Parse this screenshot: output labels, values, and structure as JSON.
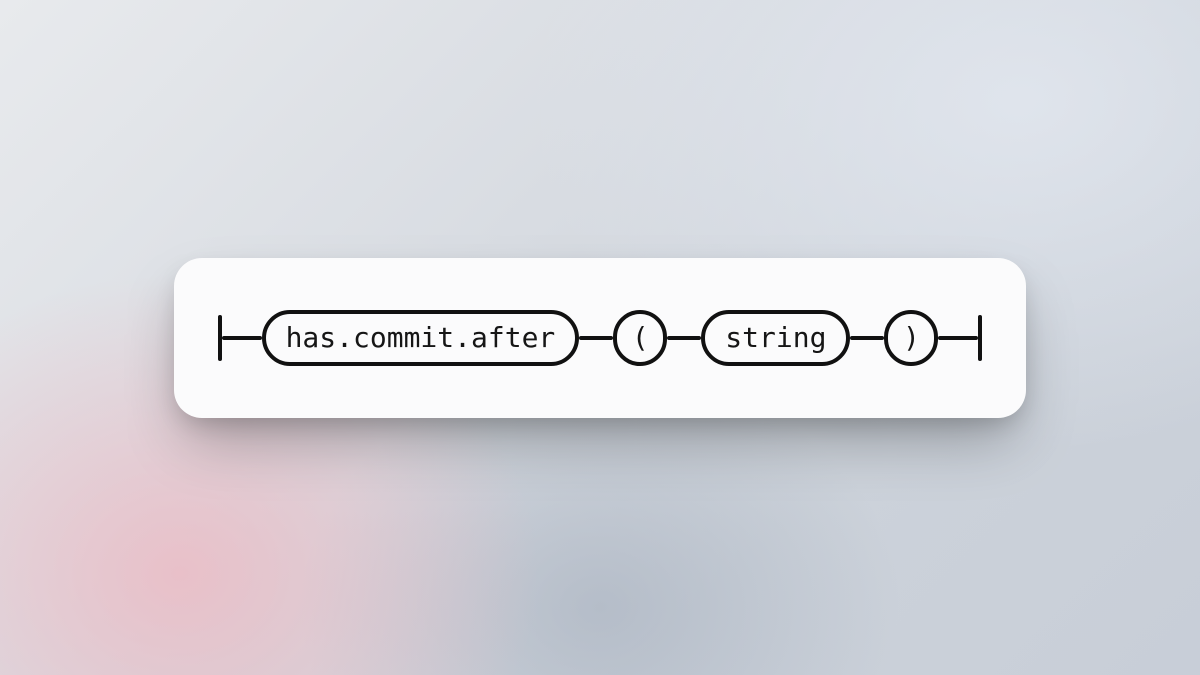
{
  "diagram": {
    "nodes": {
      "keyword": "has.commit.after",
      "open_paren": "(",
      "argument": "string",
      "close_paren": ")"
    }
  }
}
